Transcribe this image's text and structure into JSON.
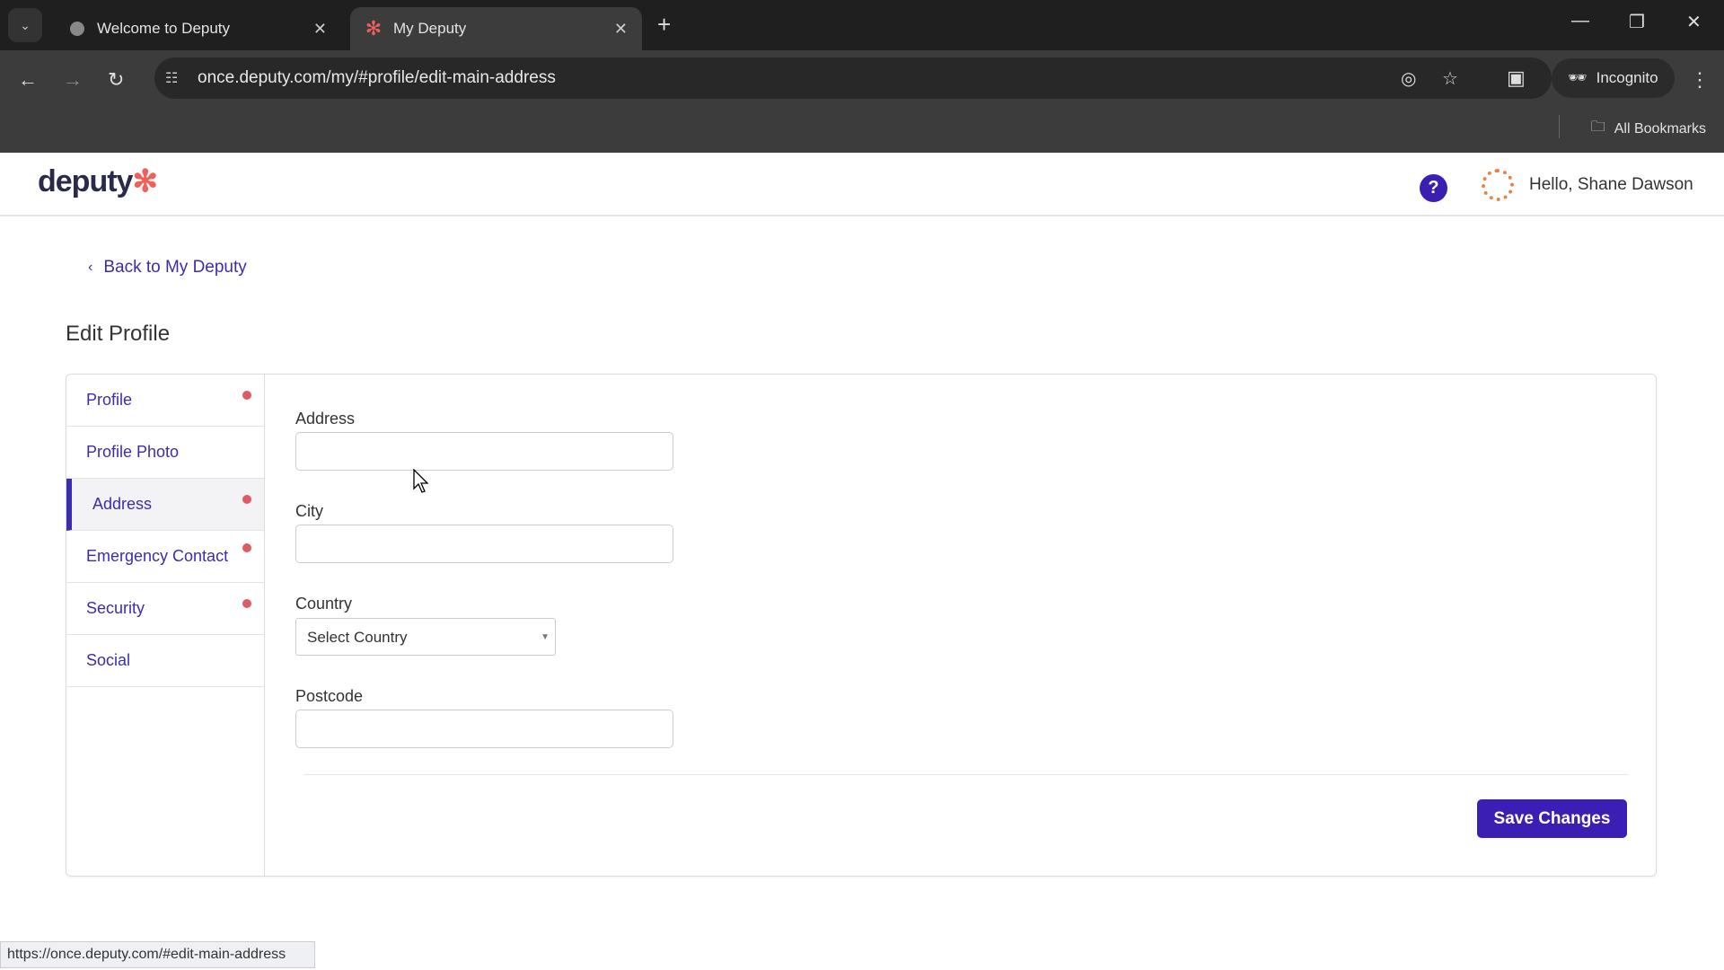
{
  "browser": {
    "tabs": [
      {
        "title": "Welcome to Deputy",
        "icon": "globe-icon"
      },
      {
        "title": "My Deputy",
        "icon": "deputy-icon",
        "active": true
      }
    ],
    "url": "once.deputy.com/my/#profile/edit-main-address",
    "incognito_label": "Incognito",
    "bookmarks_label": "All Bookmarks",
    "status_url": "https://once.deputy.com/#edit-main-address"
  },
  "header": {
    "logo": "deputy",
    "greeting": "Hello, Shane Dawson",
    "help_icon": "?"
  },
  "back_link": "Back to My Deputy",
  "page_title": "Edit Profile",
  "sidebar": {
    "items": [
      {
        "label": "Profile",
        "dot": true
      },
      {
        "label": "Profile Photo",
        "dot": false
      },
      {
        "label": "Address",
        "dot": true,
        "active": true
      },
      {
        "label": "Emergency Contact",
        "dot": true
      },
      {
        "label": "Security",
        "dot": true
      },
      {
        "label": "Social",
        "dot": false
      }
    ]
  },
  "form": {
    "address_label": "Address",
    "address_value": "",
    "city_label": "City",
    "city_value": "",
    "country_label": "Country",
    "country_value": "Select Country",
    "postcode_label": "Postcode",
    "postcode_value": "",
    "save_label": "Save Changes"
  },
  "colors": {
    "accent": "#3b1fb5",
    "dot": "#e05a63",
    "logo_star": "#f0605a"
  }
}
